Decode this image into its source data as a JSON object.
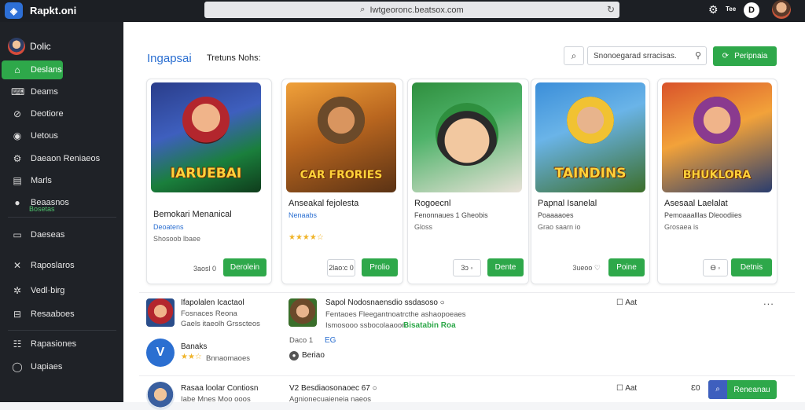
{
  "topbar": {
    "app_name": "Rapkt.oni",
    "url": "Iwtgeoronc.beatsox.com",
    "notif_badge": "Tee",
    "round_label": "D"
  },
  "sidebar": {
    "user": "Dolic",
    "items": [
      {
        "label": "Deslans",
        "icon": "home-icon",
        "glyph": "⌂",
        "active": true
      },
      {
        "label": "Deams",
        "icon": "gamepad-icon",
        "glyph": "⌨"
      },
      {
        "label": "Deotiore",
        "icon": "clip-icon",
        "glyph": "⊘"
      },
      {
        "label": "Uetous",
        "icon": "globe-icon",
        "glyph": "◉"
      },
      {
        "label": "Daeaon Reniaeos",
        "icon": "gear-icon",
        "glyph": "⚙"
      },
      {
        "label": "Marls",
        "icon": "list-icon",
        "glyph": "▤"
      },
      {
        "label": "Beaasnos",
        "icon": "avatar-icon",
        "glyph": "●"
      },
      {
        "label": "Daeseas",
        "icon": "monitor-icon",
        "glyph": "▭"
      },
      {
        "label": "Raposlaros",
        "icon": "tools-icon",
        "glyph": "✕"
      },
      {
        "label": "Vedl·birg",
        "icon": "settings-icon",
        "glyph": "✲"
      },
      {
        "label": "Resaaboes",
        "icon": "book-icon",
        "glyph": "⊟"
      },
      {
        "label": "Rapasiones",
        "icon": "grid-icon",
        "glyph": "☷"
      },
      {
        "label": "Uapiaes",
        "icon": "info-icon",
        "glyph": "◯"
      }
    ],
    "sub_label": "Bosetas"
  },
  "header": {
    "title": "Ingapsai",
    "subtitle": "Tretuns Nohs:",
    "search_placeholder": "Snonoegarad srracisas.",
    "primary_button": "Peripnaia"
  },
  "cards": [
    {
      "title": "Bemokari Menanical",
      "category": "Deoatens",
      "meta": "Shosoob lbaee",
      "price": "3aosl 0",
      "button": "Derolein",
      "banner": "IARUEBAI"
    },
    {
      "title": "Anseakal fejolesta",
      "category": "Nenaabs",
      "meta": "",
      "stars": "★★★★☆",
      "price": "2lao:c 0",
      "button": "Prolio",
      "banner": "CAR FRORIES"
    },
    {
      "title": "Rogoecnl",
      "category": "Fenonnaues 1 Gheobis",
      "meta": "Gloss",
      "price": "3ɔ ◦",
      "button": "Dente",
      "banner": ""
    },
    {
      "title": "Papnal Isanelal",
      "category": "Poaaaaoes",
      "meta": "Grao saarn io",
      "price": "3ueoo ♡",
      "button": "Poine",
      "banner": "TAINDINS"
    },
    {
      "title": "Asesaal Laelalat",
      "category": "Pemoaaalllas Dleoodiies",
      "meta": "Grosaea is",
      "price": "Ө ◦",
      "button": "Detnis",
      "banner": "BHUKLORA"
    }
  ],
  "feed": [
    {
      "name": "Ifapolalen Icactaol",
      "line2": "Fosnaces Reona",
      "line3": "Gaels itaeolh Grsscteos",
      "post_title": "Sapol Nodosnaensdio ssdasoso ○",
      "post_line2": "Fentaoes Fleegantnoatrcthe ashaopoeaes",
      "post_line3": "Ismosooo ssbocolaaoon",
      "post_link": "Bisatabin Roa",
      "post_tag": "Daco 1",
      "post_tag2": "EG",
      "post_chip": "Beriao",
      "action": "Aat",
      "dots": "..."
    },
    {
      "name": "Banaks",
      "stars": "★★☆",
      "stars_text": "Bnnaomaoes"
    },
    {
      "name": "Rasaa loolar Contiosn",
      "line2": "Iabe Mnes Moo ooos",
      "post_title": "V2 Besdiaosonaoec 67 ○",
      "post_line2": "Agnionecuaieneia naeos",
      "action": "Aat",
      "count": "Ɛ0",
      "button": "Reneanau"
    }
  ],
  "colors": {
    "accent": "#2ea84a",
    "link": "#2b6fd1",
    "sidebar": "#1f2227",
    "topbar": "#1c1f24"
  }
}
